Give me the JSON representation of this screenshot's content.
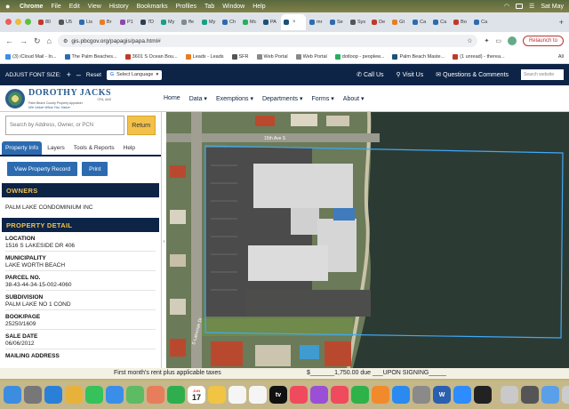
{
  "menubar": {
    "items": [
      "File",
      "Edit",
      "View",
      "History",
      "Bookmarks",
      "Profiles",
      "Tab",
      "Window",
      "Help"
    ],
    "clock": "Sat May"
  },
  "browser": {
    "tabs": [
      {
        "label": "80",
        "color": "#c0392b"
      },
      {
        "label": "U5",
        "color": "#555555"
      },
      {
        "label": "Lis",
        "color": "#2c6bb0"
      },
      {
        "label": "Br",
        "color": "#e67e22"
      },
      {
        "label": "P1",
        "color": "#8e44ad"
      },
      {
        "label": "7D",
        "color": "#2c3e50"
      },
      {
        "label": "My",
        "color": "#16a085"
      },
      {
        "label": "ffe",
        "color": "#7f8c8d"
      },
      {
        "label": "My",
        "color": "#16a085"
      },
      {
        "label": "Ch",
        "color": "#2c6bb0"
      },
      {
        "label": "Mc",
        "color": "#27ae60"
      },
      {
        "label": "PA",
        "color": "#1a5276"
      },
      {
        "label": "",
        "color": "#1a5276",
        "active": true
      },
      {
        "label": "mr",
        "color": "#2c6bb0"
      },
      {
        "label": "Se",
        "color": "#2c6bb0"
      },
      {
        "label": "Sys",
        "color": "#555555"
      },
      {
        "label": "De",
        "color": "#c0392b"
      },
      {
        "label": "Gt",
        "color": "#e67e22"
      },
      {
        "label": "Ca",
        "color": "#2c6bb0"
      },
      {
        "label": "Ca",
        "color": "#2c6bb0"
      },
      {
        "label": "Bo",
        "color": "#c0392b"
      },
      {
        "label": "Ca",
        "color": "#2c6bb0"
      }
    ],
    "url": "gis.pbcgov.org/papagis/papa.html#",
    "relaunch": "Relaunch to",
    "bookmarks": [
      "(3) iCloud Mail - In...",
      "The Palm Beaches...",
      "3601 S Ocean Bou...",
      "Leadx - Leads",
      "SFR",
      "Web Portal",
      "Web Portal",
      "dotloop - peoplew...",
      "Palm Beach Maste...",
      "(1 unread) - therea..."
    ],
    "bookmarks_more": "All"
  },
  "site": {
    "font_size_label": "ADJUST FONT SIZE:",
    "font_plus": "+",
    "font_minus": "–",
    "reset": "Reset",
    "translate": "Select Language",
    "call_us": "Call Us",
    "visit_us": "Visit Us",
    "questions": "Questions & Comments",
    "search_placeholder": "Search website",
    "logo_name": "DOROTHY JACKS",
    "logo_suffix": "CFA, AAS",
    "logo_sub": "Palm Beach County Property Appraiser",
    "logo_tag": "We Value What You Value",
    "nav": [
      "Home",
      "Data ▾",
      "Exemptions ▾",
      "Departments ▾",
      "Forms ▾",
      "About ▾"
    ],
    "search_box": "Search by Address, Owner, or PCN",
    "return_btn": "Return",
    "side_tabs": [
      "Property Info",
      "Layers",
      "Tools & Reports",
      "Help"
    ],
    "view_record": "View Property Record",
    "print": "Print",
    "owners_head": "OWNERS",
    "owner_name": "PALM LAKE CONDOMINIUM INC",
    "detail_head": "PROPERTY DETAIL",
    "fields": [
      {
        "label": "LOCATION",
        "value": "1516 S LAKESIDE DR 406"
      },
      {
        "label": "MUNICIPALITY",
        "value": "LAKE WORTH BEACH"
      },
      {
        "label": "PARCEL NO.",
        "value": "38-43-44-34-15-002-4060"
      },
      {
        "label": "SUBDIVISION",
        "value": "PALM LAKE NO 1 COND"
      },
      {
        "label": "BOOK/PAGE",
        "value": "25250/1609"
      },
      {
        "label": "SALE DATE",
        "value": "06/06/2012"
      },
      {
        "label": "MAILING ADDRESS",
        "value": ""
      }
    ],
    "map_street_top": "15th Ave S",
    "map_street_left": "S Lakeside Dr"
  },
  "lease_strip": {
    "text1": "First month's rent plus applicable taxes",
    "text2": "$_______1,750.00 due ___UPON SIGNING_____"
  },
  "dock": {
    "calendar_month": "JUN",
    "calendar_day": "17",
    "apps": [
      {
        "name": "finder-icon",
        "color": "#3c8de0",
        "glyph": ""
      },
      {
        "name": "launchpad-icon",
        "color": "#777777",
        "glyph": ""
      },
      {
        "name": "safari-icon",
        "color": "#2a7fd8",
        "glyph": ""
      },
      {
        "name": "chrome-icon",
        "color": "#e8b23a",
        "glyph": ""
      },
      {
        "name": "messages-icon",
        "color": "#36c25a",
        "glyph": ""
      },
      {
        "name": "mail-icon",
        "color": "#3b8ee8",
        "glyph": ""
      },
      {
        "name": "maps-icon",
        "color": "#5dbb63",
        "glyph": ""
      },
      {
        "name": "photos-icon",
        "color": "#e77d5a",
        "glyph": ""
      },
      {
        "name": "facetime-icon",
        "color": "#2fae4e",
        "glyph": ""
      },
      {
        "name": "calendar-icon",
        "color": "#ffffff",
        "glyph": ""
      },
      {
        "name": "notes-icon",
        "color": "#f1c443",
        "glyph": ""
      },
      {
        "name": "reminders-icon",
        "color": "#f5f5f5",
        "glyph": ""
      },
      {
        "name": "freeform-icon",
        "color": "#f5f5f5",
        "glyph": ""
      },
      {
        "name": "tv-icon",
        "color": "#111111",
        "glyph": "tv"
      },
      {
        "name": "music-icon",
        "color": "#f04a5e",
        "glyph": ""
      },
      {
        "name": "podcasts-icon",
        "color": "#9a4fd6",
        "glyph": ""
      },
      {
        "name": "news-icon",
        "color": "#f04a5e",
        "glyph": ""
      },
      {
        "name": "numbers-icon",
        "color": "#2eb24a",
        "glyph": ""
      },
      {
        "name": "pages-icon",
        "color": "#f08a2a",
        "glyph": ""
      },
      {
        "name": "appstore-icon",
        "color": "#2a8af0",
        "glyph": ""
      },
      {
        "name": "settings-icon",
        "color": "#8a8a8a",
        "glyph": ""
      },
      {
        "name": "word-icon",
        "color": "#2b5fb0",
        "glyph": "W"
      },
      {
        "name": "zoom-icon",
        "color": "#2d8cff",
        "glyph": ""
      },
      {
        "name": "quicktime-icon",
        "color": "#222222",
        "glyph": ""
      },
      {
        "name": "preview-icon",
        "color": "#c9c9c9",
        "glyph": ""
      },
      {
        "name": "screenshot-icon",
        "color": "#555555",
        "glyph": ""
      },
      {
        "name": "downloads-icon",
        "color": "#5aa0e8",
        "glyph": ""
      },
      {
        "name": "trash-icon",
        "color": "#cccccc",
        "glyph": ""
      }
    ]
  }
}
